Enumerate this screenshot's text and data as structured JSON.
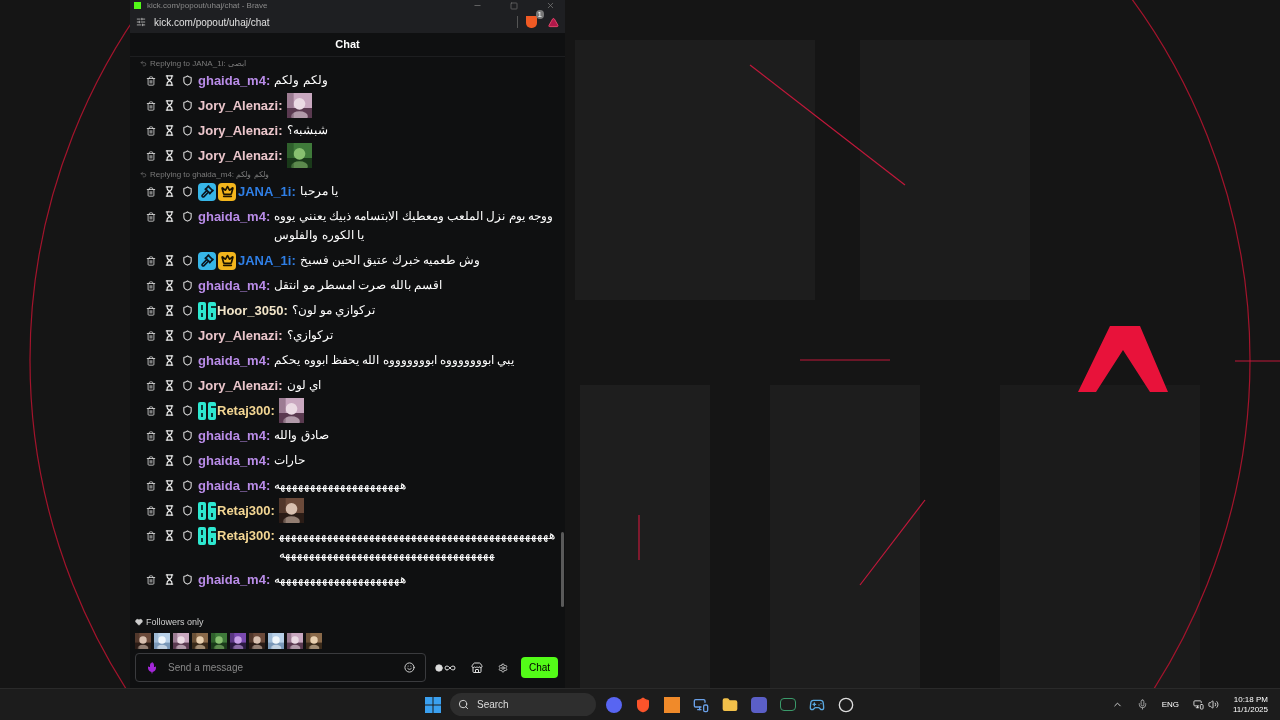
{
  "window": {
    "title": "kick.com/popout/uhaj/chat - Brave",
    "url": "kick.com/popout/uhaj/chat",
    "shield_count": "1"
  },
  "chat": {
    "title": "Chat",
    "items": [
      {
        "kind": "reply",
        "text": "Replying to JANA_1i: ابصى"
      },
      {
        "kind": "message",
        "user": "ghaida_m4:",
        "color": "#b98ce8",
        "text": "ولكم ولكم"
      },
      {
        "user": "Jory_Alenazi:",
        "color": "#ecc6cc"
      },
      {
        "kind": "message",
        "user": "Jory_Alenazi:",
        "color": "#ecc6cc",
        "text": "شبشبه؟"
      },
      {
        "user": "Jory_Alenazi:",
        "color": "#ecc6cc"
      },
      {
        "kind": "reply",
        "text": "Replying to ghaida_m4: ولكم ولكم"
      },
      {
        "kind": "message",
        "user": "JANA_1i:",
        "color": "#2f7fe6",
        "badges": [
          {
            "kind": "moderator"
          },
          {
            "kind": "crown"
          }
        ],
        "text": "يا مرحبا"
      },
      {
        "kind": "message",
        "user": "ghaida_m4:",
        "color": "#b98ce8",
        "text": "ووجه يوم نزل الملعب ومعطيك الابتسامه ذبيك يعنني يووه يا الكوره والفلوس"
      },
      {
        "kind": "message",
        "user": "JANA_1i:",
        "color": "#2f7fe6",
        "badges": [
          {
            "kind": "moderator"
          },
          {
            "kind": "crown"
          }
        ],
        "text": "وش طعميه خبرك عتيق الحين فسيخ"
      },
      {
        "kind": "message",
        "user": "ghaida_m4:",
        "color": "#b98ce8",
        "text": "اقسم بالله صرت امسطر مو انتقل"
      },
      {
        "kind": "message",
        "user": "Hoor_3050:",
        "color": "#f1e4c8",
        "badges": [
          {
            "kind": "og"
          }
        ],
        "text": "تركوازي مو لون؟"
      },
      {
        "kind": "message",
        "user": "Jory_Alenazi:",
        "color": "#ecc6cc",
        "text": "تركوازي؟"
      },
      {
        "kind": "message",
        "user": "ghaida_m4:",
        "color": "#b98ce8",
        "text": "يبي ابوووووووه ابوووووووه الله يحفظ ابووه يحكم"
      },
      {
        "kind": "message",
        "user": "Jory_Alenazi:",
        "color": "#ecc6cc",
        "text": "اي لون"
      },
      {
        "user": "Retaj300:",
        "color": "#f3d693",
        "badges": [
          {
            "kind": "og"
          }
        ]
      },
      {
        "kind": "message",
        "user": "ghaida_m4:",
        "color": "#b98ce8",
        "text": "صادق والله"
      },
      {
        "kind": "message",
        "user": "ghaida_m4:",
        "color": "#b98ce8",
        "text": "حارات"
      },
      {
        "kind": "message",
        "user": "ghaida_m4:",
        "color": "#b98ce8",
        "text": "هههههههههههههههههههههه"
      },
      {
        "user": "Retaj300:",
        "color": "#f3d693",
        "badges": [
          {
            "kind": "og"
          }
        ]
      },
      {
        "kind": "message",
        "user": "Retaj300:",
        "color": "#f3d693",
        "badges": [
          {
            "kind": "og"
          }
        ],
        "text": "هههههههههههههههههههههههههههههههههههههههههههههههههههههههههههههههههههههههههههههههههه"
      },
      {
        "kind": "message",
        "user": "ghaida_m4:",
        "color": "#b98ce8",
        "text": "هههههههههههههههههههههه"
      }
    ],
    "mode": "Followers only",
    "placeholder": "Send a message",
    "send": "Chat"
  },
  "taskbar": {
    "search": "Search",
    "language": "ENG",
    "time": "10:18 PM",
    "date": "11/1/2025"
  }
}
